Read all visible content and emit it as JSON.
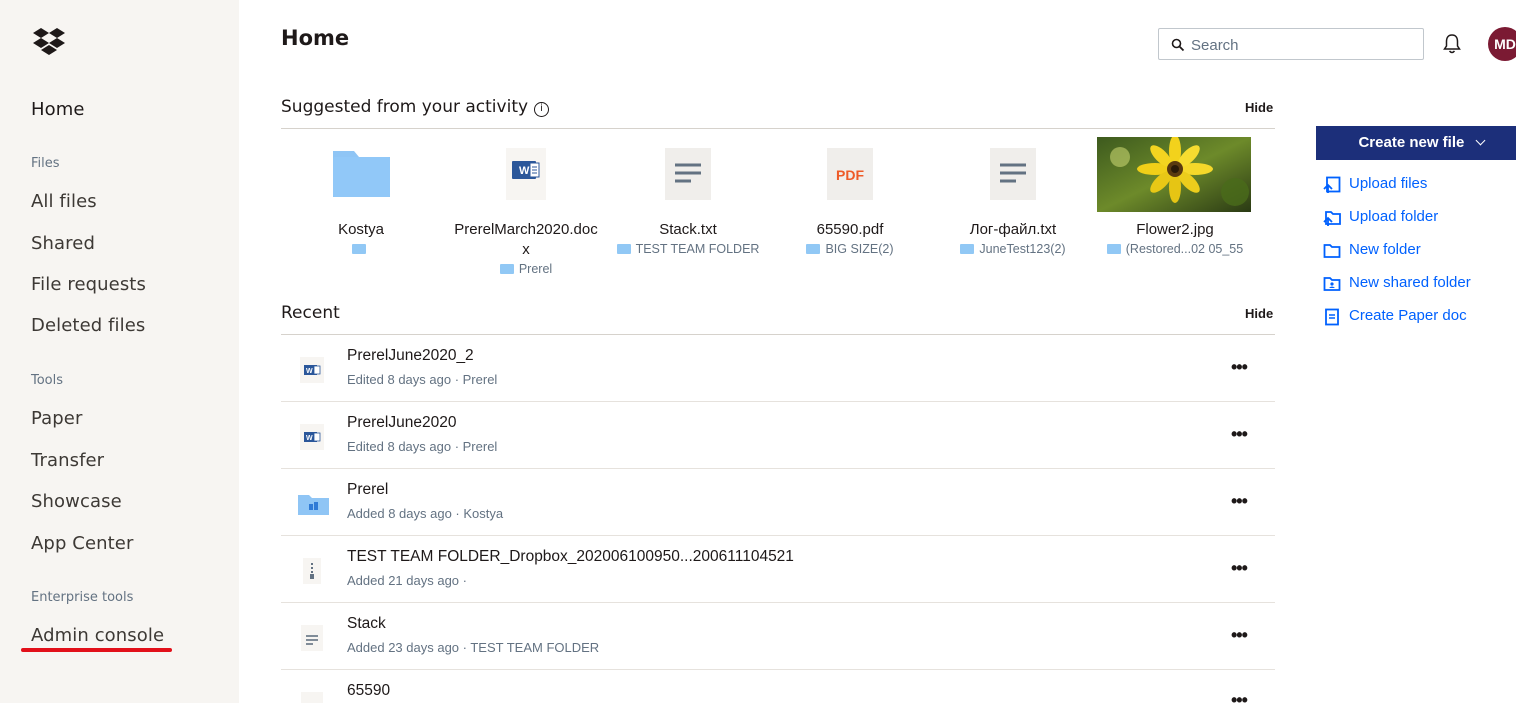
{
  "sidebar": {
    "home": "Home",
    "files_heading": "Files",
    "all_files": "All files",
    "shared": "Shared",
    "file_requests": "File requests",
    "deleted_files": "Deleted files",
    "tools_heading": "Tools",
    "paper": "Paper",
    "transfer": "Transfer",
    "showcase": "Showcase",
    "app_center": "App Center",
    "enterprise_heading": "Enterprise tools",
    "admin_console": "Admin console"
  },
  "header": {
    "title": "Home",
    "search_placeholder": "Search",
    "avatar_initials": "MD"
  },
  "suggested": {
    "title": "Suggested from your activity",
    "hide": "Hide",
    "items": [
      {
        "name": "Kostya",
        "location": ""
      },
      {
        "name": "PrerelMarch2020.doc x",
        "location": "Prerel"
      },
      {
        "name": "Stack.txt",
        "location": "TEST TEAM FOLDER"
      },
      {
        "name": "65590.pdf",
        "location": "BIG SIZE(2)"
      },
      {
        "name": "Лог-файл.txt",
        "location": "JuneTest123(2)"
      },
      {
        "name": "Flower2.jpg",
        "location": "(Restored...02 05_55"
      }
    ],
    "pdf_label": "PDF"
  },
  "recent": {
    "title": "Recent",
    "hide": "Hide",
    "more_label": "•••",
    "rows": [
      {
        "name": "PrerelJune2020_2",
        "meta": "Edited 8 days ago · Prerel",
        "icon": "word-file-icon"
      },
      {
        "name": "PrerelJune2020",
        "meta": "Edited 8 days ago · Prerel",
        "icon": "word-file-icon"
      },
      {
        "name": "Prerel",
        "meta": "Added 8 days ago · Kostya",
        "icon": "team-folder-icon"
      },
      {
        "name": "TEST TEAM FOLDER_Dropbox_202006100950...200611104521",
        "meta": "Added 21 days ago ·",
        "icon": "zip-file-icon"
      },
      {
        "name": "Stack",
        "meta": "Added 23 days ago · TEST TEAM FOLDER",
        "icon": "text-file-icon"
      },
      {
        "name": "65590",
        "meta": "",
        "icon": "pdf-file-icon"
      }
    ]
  },
  "actions": {
    "create_new_file": "Create new file",
    "upload_files": "Upload files",
    "upload_folder": "Upload folder",
    "new_folder": "New folder",
    "new_shared_folder": "New shared folder",
    "create_paper_doc": "Create Paper doc"
  },
  "colors": {
    "accent": "#0061fe",
    "create_button": "#1c2f7a",
    "highlight_underline": "#e2101a",
    "sidebar_bg": "#f7f5f2"
  }
}
